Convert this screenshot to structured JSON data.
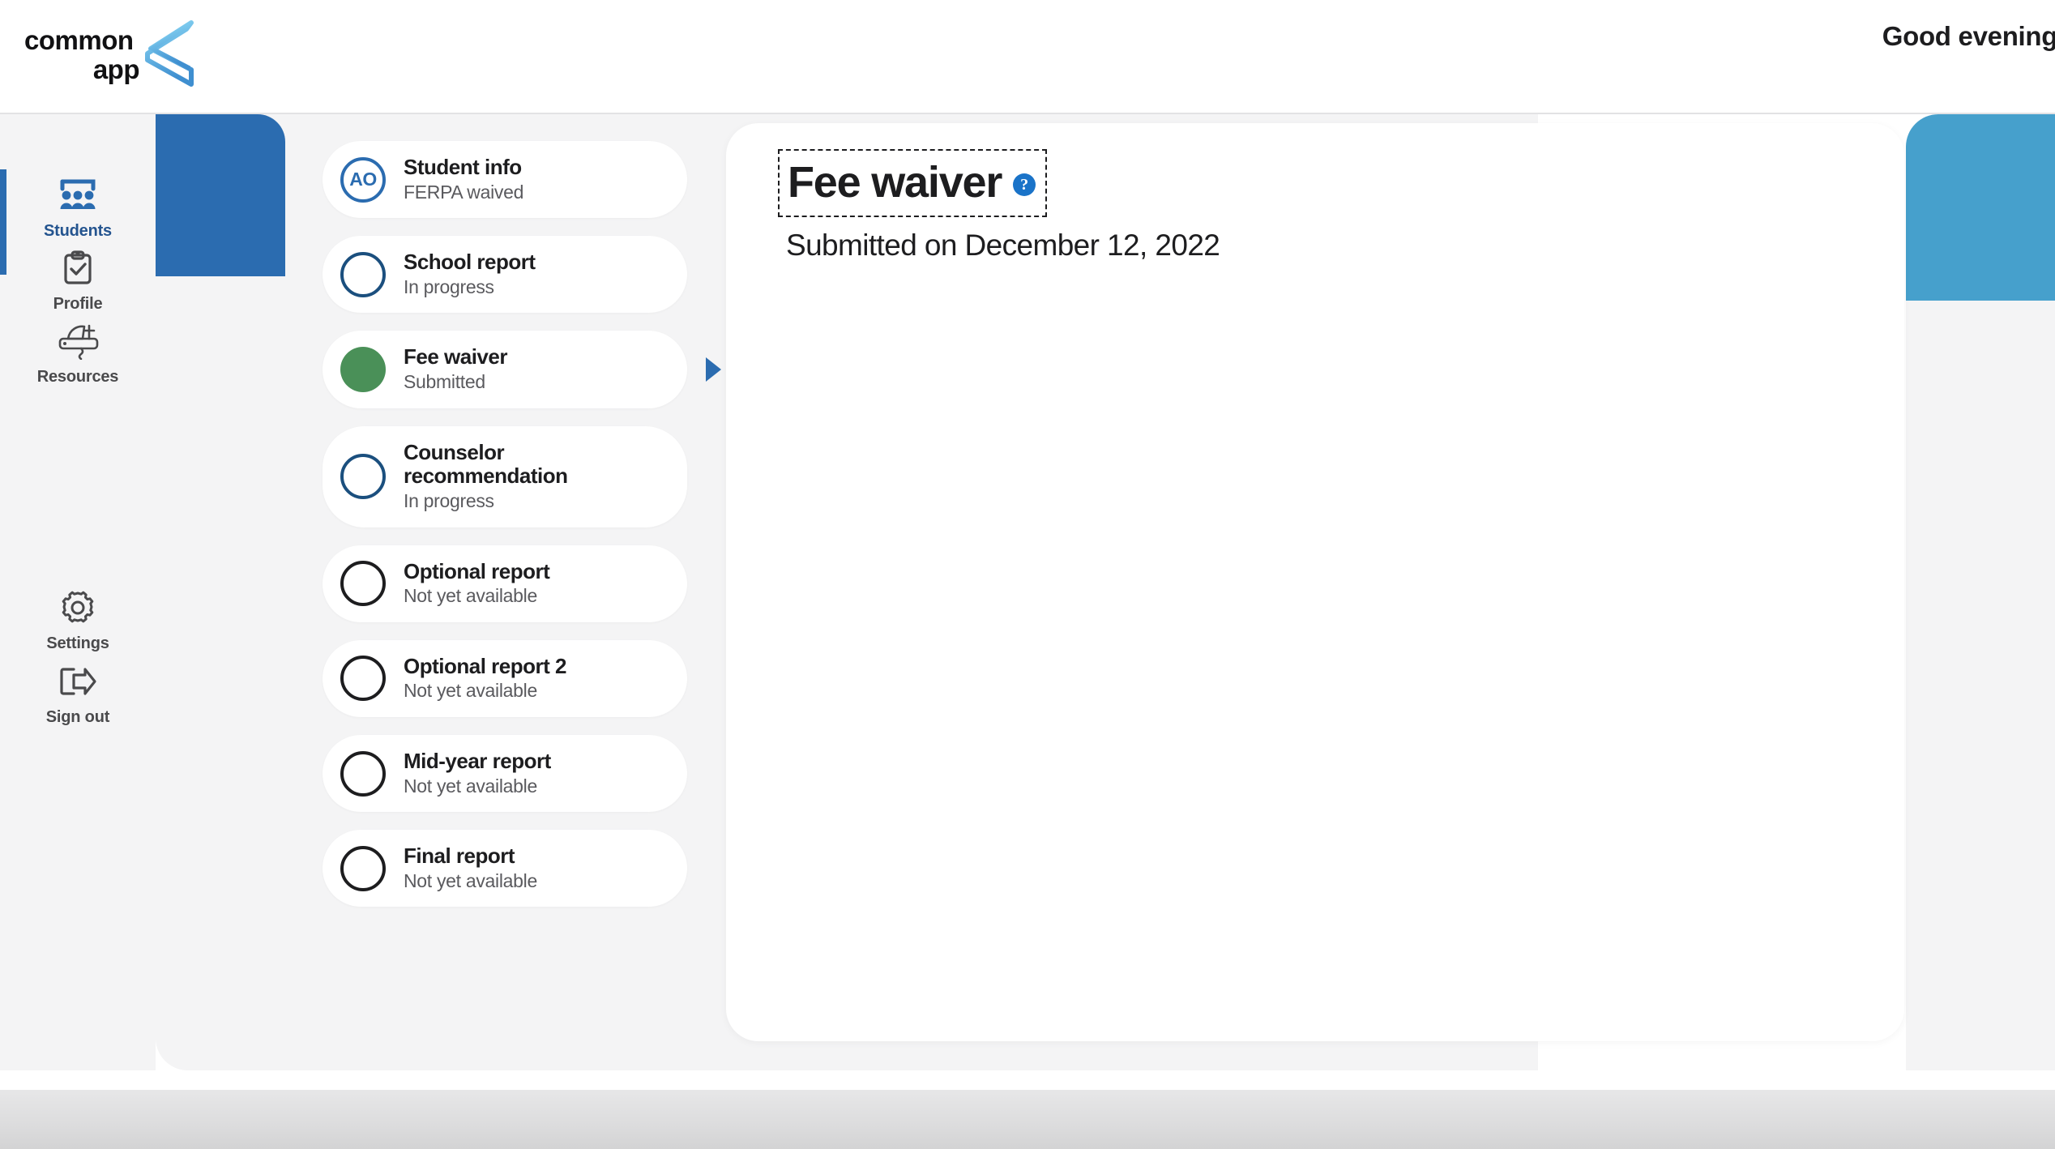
{
  "brand": {
    "logo_line1": "common",
    "logo_line2": "app",
    "logo_mark_name": "commonapp-ribbon-logo",
    "accent_blue": "#2b6cb0",
    "accent_light_blue": "#46a0cc",
    "accent_green": "#4a9058",
    "logo_gradient_start": "#8fdcf7",
    "logo_gradient_end": "#3f8fd0"
  },
  "header": {
    "greeting": "Good evening,"
  },
  "sidebar": {
    "items": [
      {
        "label": "Students",
        "icon": "students-group-icon",
        "active": true
      },
      {
        "label": "Profile",
        "icon": "clipboard-check-icon",
        "active": false
      },
      {
        "label": "Resources",
        "icon": "swiss-army-knife-icon",
        "active": false
      },
      {
        "label": "Settings",
        "icon": "gear-icon",
        "active": false
      },
      {
        "label": "Sign out",
        "icon": "sign-out-icon",
        "active": false
      }
    ]
  },
  "checklist": {
    "items": [
      {
        "title": "Student info",
        "status": "FERPA waived",
        "marker": "initials",
        "initials": "AO",
        "selected": false
      },
      {
        "title": "School report",
        "status": "In progress",
        "marker": "navy",
        "selected": false
      },
      {
        "title": "Fee waiver",
        "status": "Submitted",
        "marker": "green",
        "selected": true
      },
      {
        "title": "Counselor recommendation",
        "status": "In progress",
        "marker": "navy",
        "selected": false
      },
      {
        "title": "Optional report",
        "status": "Not yet available",
        "marker": "empty",
        "selected": false
      },
      {
        "title": "Optional report 2",
        "status": "Not yet available",
        "marker": "empty",
        "selected": false
      },
      {
        "title": "Mid-year report",
        "status": "Not yet available",
        "marker": "empty",
        "selected": false
      },
      {
        "title": "Final report",
        "status": "Not yet available",
        "marker": "empty",
        "selected": false
      }
    ]
  },
  "main": {
    "title": "Fee waiver",
    "help_icon": "question-mark-help-icon",
    "help_glyph": "?",
    "submitted_on": "Submitted on December 12, 2022"
  }
}
